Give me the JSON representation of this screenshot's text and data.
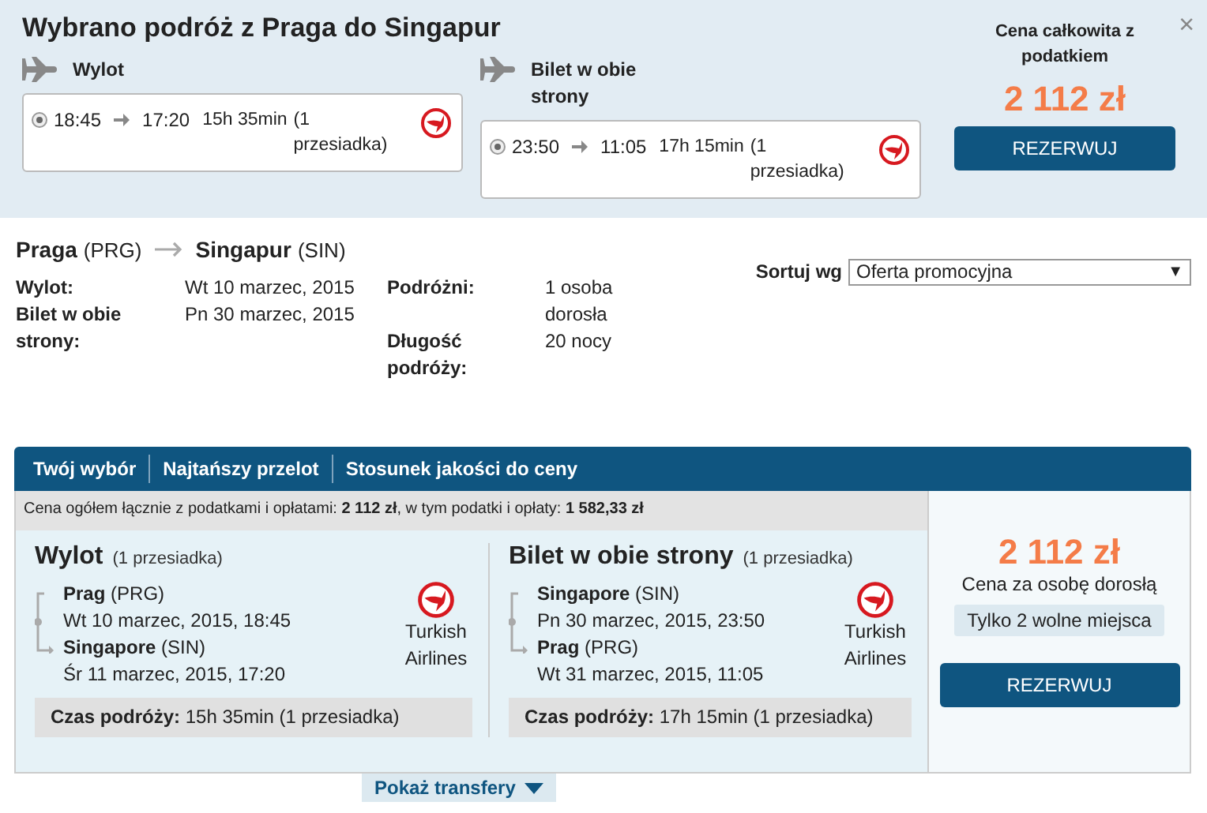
{
  "summary": {
    "title": "Wybrano podróż z Praga do Singapur",
    "close": "×",
    "legs": [
      {
        "label": "Wylot",
        "selected": true,
        "depart": "18:45",
        "arrive": "17:20",
        "duration": "15h 35min",
        "stops": "(1 przesiadka)"
      },
      {
        "label": "Bilet w obie strony",
        "selected": true,
        "depart": "23:50",
        "arrive": "11:05",
        "duration": "17h 15min",
        "stops": "(1 przesiadka)"
      }
    ],
    "price_label": "Cena całkowita z podatkiem",
    "price": "2 112 zł",
    "book": "REZERWUJ"
  },
  "route": {
    "from": "Praga",
    "from_code": "(PRG)",
    "to": "Singapur",
    "to_code": "(SIN)",
    "details": [
      {
        "label": "Wylot:",
        "value": "Wt 10 marzec, 2015"
      },
      {
        "label": "Bilet w obie strony:",
        "value": "Pn 30 marzec, 2015"
      }
    ],
    "details_2": [
      {
        "label": "Podróżni:",
        "value": "1 osoba dorosła"
      },
      {
        "label": "Długość podróży:",
        "value": "20 nocy"
      }
    ],
    "sort_label": "Sortuj wg",
    "sort_value": "Oferta promocyjna",
    "sort_caret": "▼"
  },
  "tabs": [
    "Twój wybór",
    "Najtańszy przelot",
    "Stosunek jakości do ceny"
  ],
  "offer": {
    "total": "Cena ogółem łącznie z podatkami i opłatami: **2 112 zł**, w tym podatki i opłaty: **1 582,33 zł**",
    "legs": [
      {
        "title": "Wylot",
        "stops": "(1 przesiadka)",
        "from": "Prag",
        "from_code": "(PRG)",
        "from_time": "Wt 10 marzec, 2015, 18:45",
        "to": "Singapore",
        "to_code": "(SIN)",
        "to_time": "Śr 11 marzec, 2015, 17:20",
        "airline": "Turkish Airlines",
        "duration_label": "Czas podróży:",
        "duration": "15h 35min (1 przesiadka)"
      },
      {
        "title": "Bilet w obie strony",
        "stops": "(1 przesiadka)",
        "from": "Singapore",
        "from_code": "(SIN)",
        "from_time": "Pn 30 marzec, 2015, 23:50",
        "to": "Prag",
        "to_code": "(PRG)",
        "to_time": "Wt 31 marzec, 2015, 11:05",
        "airline": "Turkish Airlines",
        "duration_label": "Czas podróży:",
        "duration": "17h 15min (1 przesiadka)"
      }
    ],
    "price": "2 112 zł",
    "price_note": "Cena za osobę dorosłą",
    "seats": "Tylko 2 wolne miejsca",
    "book": "REZERWUJ"
  },
  "transfers": "Pokaż transfery"
}
